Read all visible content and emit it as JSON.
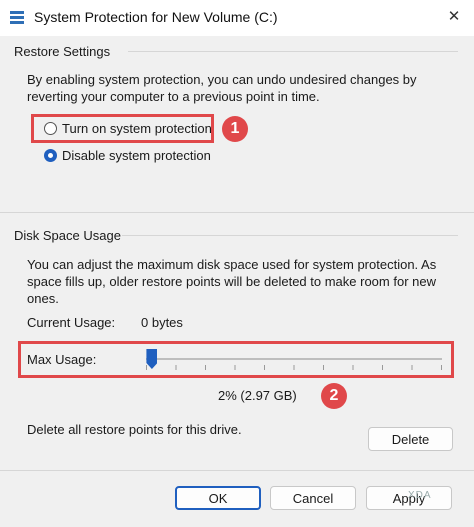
{
  "window": {
    "title": "System Protection for New Volume (C:)",
    "close_glyph": "✕"
  },
  "restore_settings": {
    "title": "Restore Settings",
    "description": "By enabling system protection, you can undo undesired changes by reverting your computer to a previous point in time.",
    "options": [
      {
        "label": "Turn on system protection",
        "selected": false
      },
      {
        "label": "Disable system protection",
        "selected": true
      }
    ],
    "callout_number": "1"
  },
  "disk_space": {
    "title": "Disk Space Usage",
    "description": "You can adjust the maximum disk space used for system protection. As space fills up, older restore points will be deleted to make room for new ones.",
    "current_usage_label": "Current Usage:",
    "current_usage_value": "0 bytes",
    "max_usage_label": "Max Usage:",
    "max_usage_percent": 2,
    "max_usage_value": "2% (2.97 GB)",
    "callout_number": "2",
    "delete_text": "Delete all restore points for this drive.",
    "delete_button": "Delete"
  },
  "footer": {
    "ok": "OK",
    "cancel": "Cancel",
    "apply": "Apply"
  },
  "watermark": "XDA",
  "colors": {
    "accent": "#1f5fbf",
    "annotation": "#e0484a"
  }
}
